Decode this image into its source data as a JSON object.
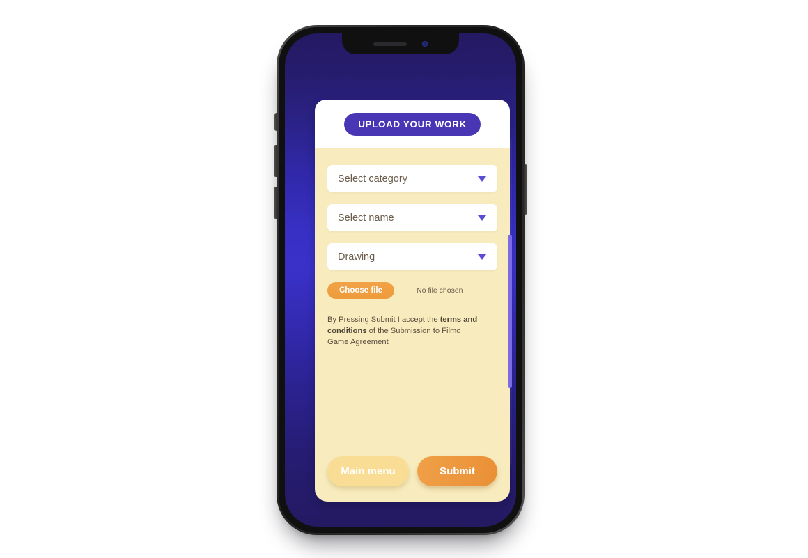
{
  "app": {
    "title": "UPLOAD YOUR WORK",
    "device": "smartphone-mockup"
  },
  "colors": {
    "accent_purple": "#4836b4",
    "caret_purple": "#5b4cd6",
    "card_yellow": "#f8ecbe",
    "orange": "#ee9b3b",
    "light_yellow": "#f9dd94",
    "screen_blue": "#3830c4",
    "screen_navy": "#241a63",
    "scrollbar_thumb": "#7b6ce6",
    "text_brown": "#6b5c4b"
  },
  "form": {
    "dropdowns": [
      {
        "name": "category",
        "value": "Select category",
        "icon": "chevron-down-icon"
      },
      {
        "name": "name",
        "value": "Select name",
        "icon": "chevron-down-icon"
      },
      {
        "name": "type",
        "value": "Drawing",
        "icon": "chevron-down-icon"
      }
    ],
    "file_upload": {
      "button_label": "Choose file",
      "status": "No file chosen"
    },
    "terms": {
      "prefix": "By Pressing Submit I accept the ",
      "link": "terms and conditions",
      "suffix": " of the Submission to Filmo Game Agreement"
    }
  },
  "footer": {
    "main_menu_label": "Main menu",
    "submit_label": "Submit"
  },
  "device_chrome": {
    "notch_speaker": "speaker-grille",
    "notch_camera": "front-camera",
    "buttons": [
      "mute-switch",
      "volume-up",
      "volume-down",
      "power"
    ]
  }
}
